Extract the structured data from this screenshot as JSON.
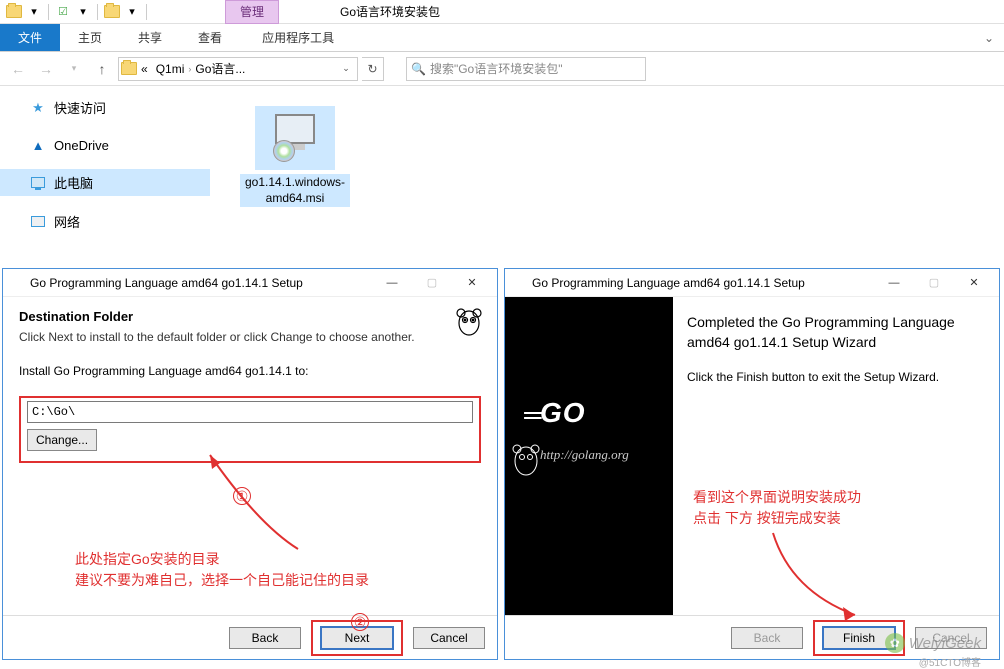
{
  "explorer": {
    "contextual_tab_group": "管理",
    "window_title": "Go语言环境安装包",
    "ribbon": {
      "file_tab": "文件",
      "tabs": [
        "主页",
        "共享",
        "查看"
      ],
      "contextual_tab": "应用程序工具"
    },
    "address": {
      "prefix": "«",
      "seg1": "Q1mi",
      "seg2": "Go语言..."
    },
    "search_placeholder": "搜索\"Go语言环境安装包\"",
    "navpane": {
      "quick_access": "快速访问",
      "onedrive": "OneDrive",
      "this_pc": "此电脑",
      "network": "网络"
    },
    "file": {
      "name": "go1.14.1.windows-amd64.msi"
    }
  },
  "dialog1": {
    "title": "Go Programming Language amd64 go1.14.1 Setup",
    "heading": "Destination Folder",
    "subheading": "Click Next to install to the default folder or click Change to choose another.",
    "install_to_label": "Install Go Programming Language amd64 go1.14.1 to:",
    "path_value": "C:\\Go\\",
    "change_btn": "Change...",
    "back_btn": "Back",
    "next_btn": "Next",
    "cancel_btn": "Cancel",
    "anno_num1": "①",
    "anno_num2": "②",
    "anno_text_line1": "此处指定Go安装的目录",
    "anno_text_line2": "建议不要为难自己，选择一个自己能记住的目录"
  },
  "dialog2": {
    "title": "Go Programming Language amd64 go1.14.1 Setup",
    "sidebar_logo": "GO",
    "sidebar_lines": "==",
    "sidebar_url": "http://golang.org",
    "heading": "Completed the Go Programming Language amd64 go1.14.1 Setup Wizard",
    "body_text": "Click the Finish button to exit the Setup Wizard.",
    "back_btn": "Back",
    "finish_btn": "Finish",
    "cancel_btn": "Cancel",
    "anno_text_line1": "看到这个界面说明安装成功",
    "anno_text_line2": "点击 下方 按钮完成安装"
  },
  "watermark": {
    "text": "WeiyiGeek",
    "sub": "@51CTO博客"
  }
}
